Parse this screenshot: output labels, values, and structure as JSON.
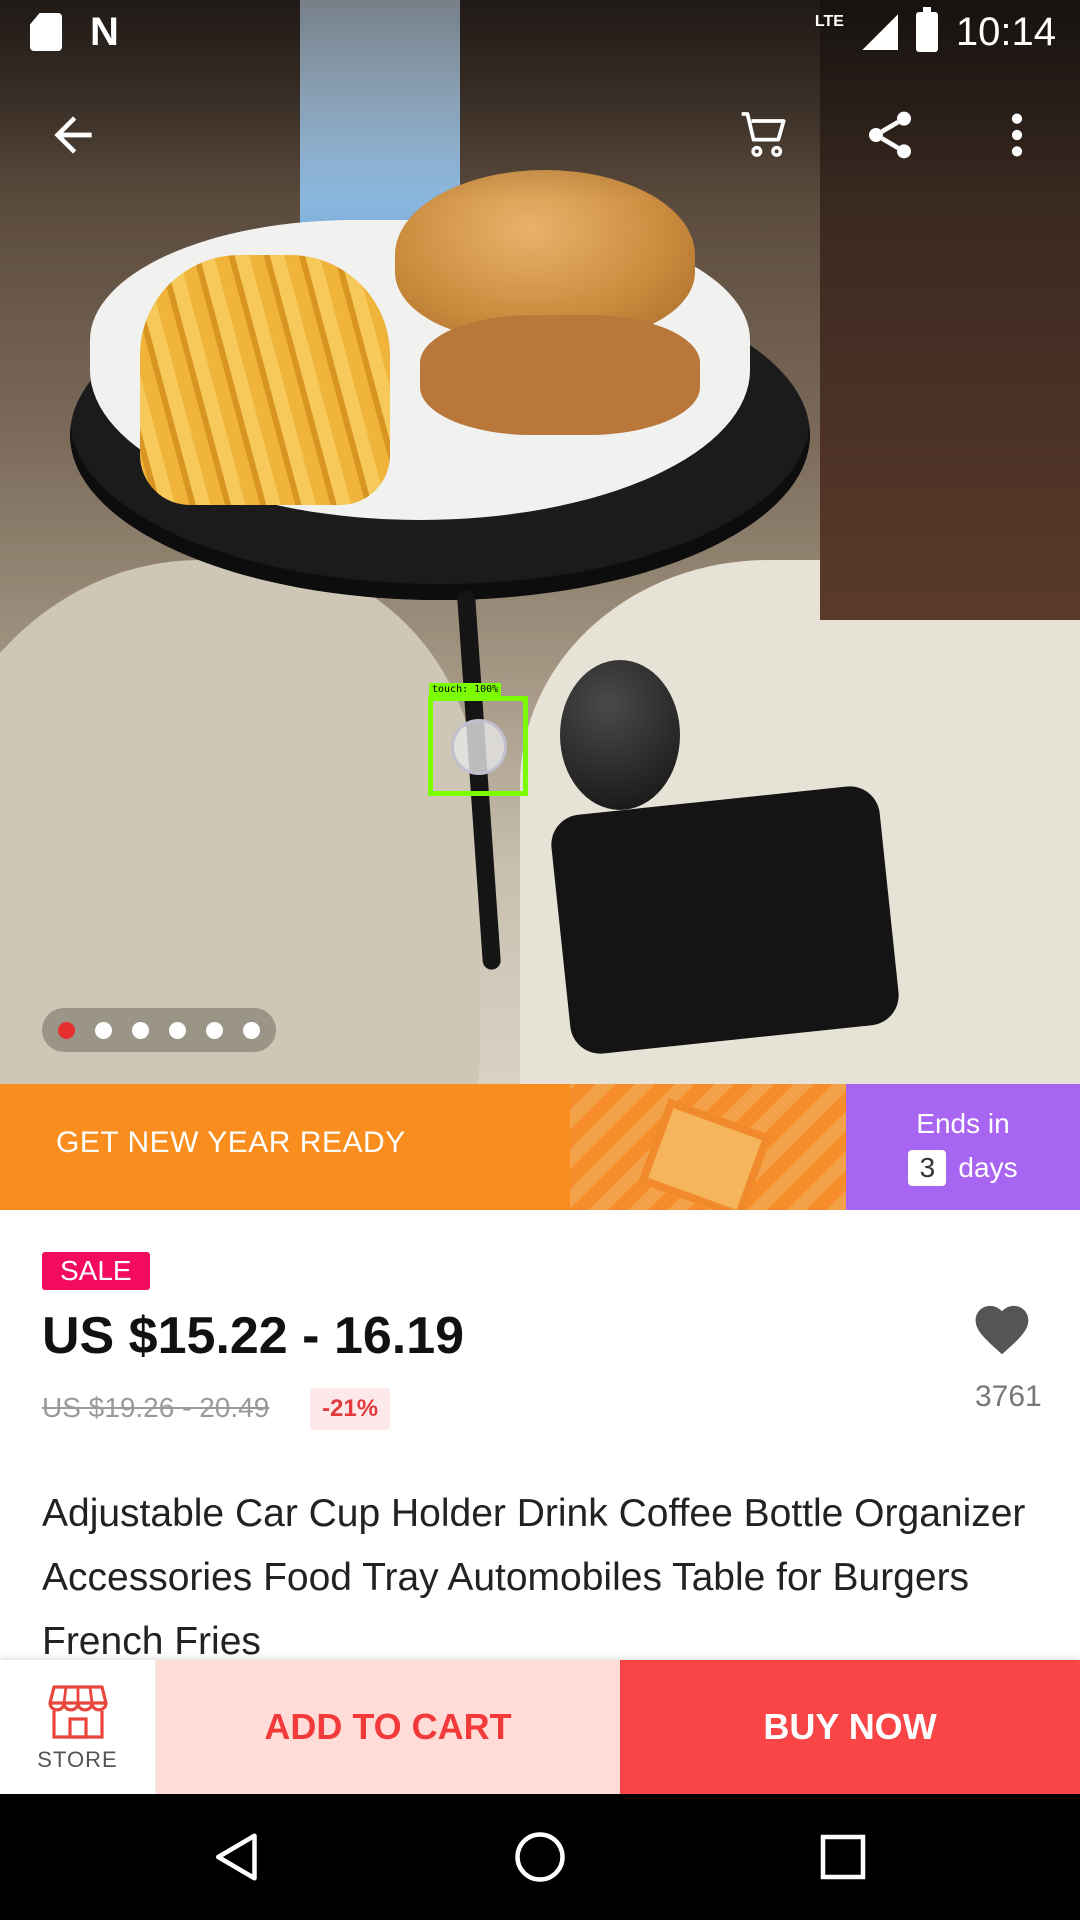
{
  "status_bar": {
    "network": "LTE",
    "time": "10:14"
  },
  "promo": {
    "title": "GET NEW YEAR READY",
    "ends_label": "Ends in",
    "days_count": "3",
    "days_label": "days"
  },
  "gallery": {
    "image_count": 6,
    "active_index": 0
  },
  "touch_overlay": {
    "label": "touch: 100%"
  },
  "product": {
    "sale_badge": "SALE",
    "price": "US $15.22 - 16.19",
    "original_price": "US $19.26 - 20.49",
    "discount": "-21%",
    "favorites_count": "3761",
    "title": "Adjustable Car Cup Holder Drink Coffee Bottle Organizer Accessories Food Tray Automobiles Table for Burgers French Fries"
  },
  "actions": {
    "store_label": "STORE",
    "add_to_cart": "ADD TO CART",
    "buy_now": "BUY NOW"
  },
  "colors": {
    "promo_orange": "#f98e1f",
    "timer_purple": "#a865f2",
    "sale_pink": "#f20b5e",
    "buy_red": "#f94546",
    "add_cart_bg": "#ffdcd8",
    "active_dot": "#e62e2e"
  },
  "icons": [
    "back-arrow-icon",
    "cart-icon",
    "share-icon",
    "more-vert-icon",
    "heart-icon",
    "store-icon",
    "nav-back-icon",
    "nav-home-icon",
    "nav-recents-icon"
  ]
}
